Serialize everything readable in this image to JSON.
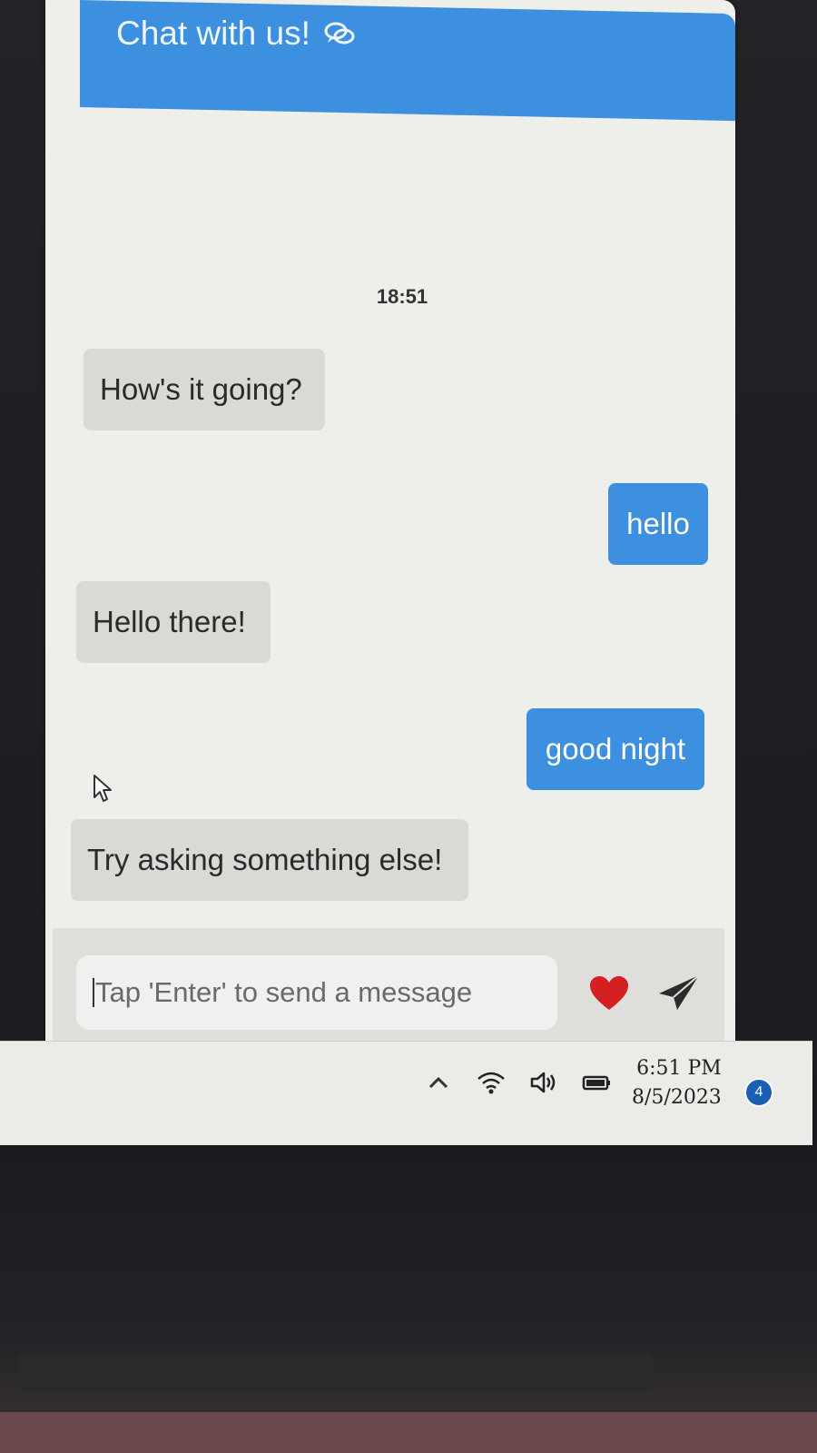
{
  "header": {
    "title": "Chat with us!",
    "icon": "chat-bubbles-icon"
  },
  "conversation": {
    "timestamp": "18:51",
    "messages": [
      {
        "sender": "bot",
        "text": "How's it going?"
      },
      {
        "sender": "user",
        "text": "hello"
      },
      {
        "sender": "bot",
        "text": "Hello there!"
      },
      {
        "sender": "user",
        "text": "good night"
      },
      {
        "sender": "bot",
        "text": "Try asking something else!"
      }
    ]
  },
  "composer": {
    "placeholder": "Tap 'Enter' to send a message",
    "heart_icon": "heart-icon",
    "send_icon": "send-icon"
  },
  "taskbar": {
    "time": "6:51 PM",
    "date": "8/5/2023",
    "notification_count": "4",
    "tray_icons": [
      "chevron-up-icon",
      "wifi-icon",
      "speaker-icon",
      "battery-icon"
    ]
  },
  "colors": {
    "accent": "#3d8fe0",
    "bot_bubble": "#d9d9d5",
    "heart": "#d42020"
  }
}
